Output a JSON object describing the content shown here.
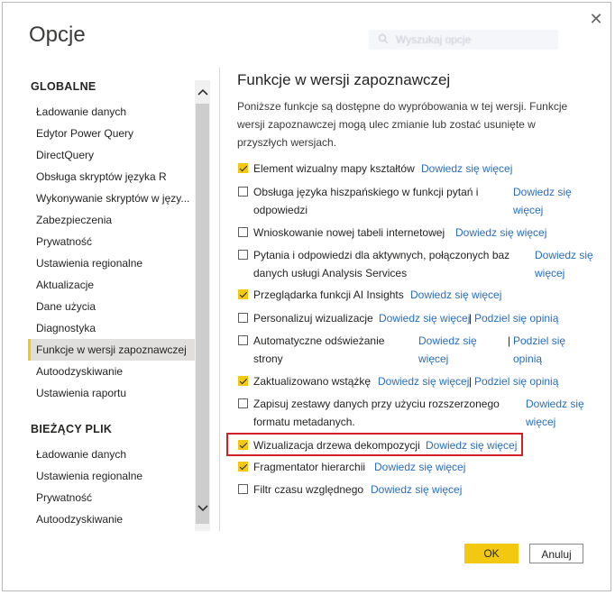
{
  "dialog": {
    "title": "Opcje",
    "search_placeholder": "Wyszukaj opcje"
  },
  "nav": {
    "global_heading": "GLOBALNE",
    "global_items": [
      "Ładowanie danych",
      "Edytor Power Query",
      "DirectQuery",
      "Obsługa skryptów języka R",
      "Wykonywanie skryptów w języ...",
      "Zabezpieczenia",
      "Prywatność",
      "Ustawienia regionalne",
      "Aktualizacje",
      "Dane użycia",
      "Diagnostyka",
      "Funkcje w wersji zapoznawczej",
      "Autoodzyskiwanie",
      "Ustawienia raportu"
    ],
    "current_heading": "BIEŻĄCY PLIK",
    "current_items": [
      "Ładowanie danych",
      "Ustawienia regionalne",
      "Prywatność",
      "Autoodzyskiwanie"
    ],
    "selected": "Funkcje w wersji zapoznawczej"
  },
  "content": {
    "title": "Funkcje w wersji zapoznawczej",
    "description": "Poniższe funkcje są dostępne do wypróbowania w tej wersji. Funkcje wersji zapoznawczej mogą ulec zmianie lub zostać usunięte w przyszłych wersjach.",
    "link_learn": "Dowiedz się więcej",
    "link_feedback": "Podziel się opinią",
    "features": [
      {
        "label": "Element wizualny mapy kształtów",
        "checked": true
      },
      {
        "label": "Obsługa języka hiszpańskiego w funkcji pytań i odpowiedzi",
        "checked": false
      },
      {
        "label": "Wnioskowanie nowej tabeli internetowej",
        "checked": false
      },
      {
        "label": "Pytania i odpowiedzi dla aktywnych, połączonych baz danych usługi Analysis Services",
        "checked": false
      },
      {
        "label": "Przeglądarka funkcji AI Insights",
        "checked": true
      },
      {
        "label": "Personalizuj wizualizacje",
        "checked": false
      },
      {
        "label": "Automatyczne odświeżanie strony",
        "checked": false
      },
      {
        "label": "Zaktualizowano wstążkę",
        "checked": true
      },
      {
        "label": "Zapisuj zestawy danych przy użyciu rozszerzonego formatu metadanych.",
        "checked": false
      },
      {
        "label": "Wizualizacja drzewa dekompozycji",
        "checked": true
      },
      {
        "label": "Fragmentator hierarchii",
        "checked": true
      },
      {
        "label": "Filtr czasu względnego",
        "checked": false
      }
    ]
  },
  "buttons": {
    "ok": "OK",
    "cancel": "Anuluj"
  },
  "colors": {
    "accent": "#f2c811",
    "link": "#2a6ebb",
    "highlight": "#d32029"
  }
}
